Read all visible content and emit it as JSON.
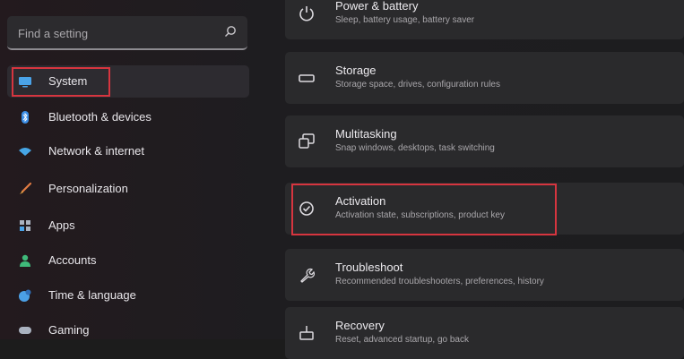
{
  "search": {
    "placeholder": "Find a setting"
  },
  "sidebar": {
    "items": [
      {
        "label": "System",
        "icon": "monitor-icon",
        "color": "#4aa3e8",
        "selected": true
      },
      {
        "label": "Bluetooth & devices",
        "icon": "bluetooth-icon",
        "color": "#3c8ee6",
        "selected": false
      },
      {
        "label": "Network & internet",
        "icon": "wifi-icon",
        "color": "#46a6e6",
        "selected": false
      },
      {
        "label": "Personalization",
        "icon": "brush-icon",
        "color": "#e27c43",
        "selected": false
      },
      {
        "label": "Apps",
        "icon": "apps-icon",
        "color": "#9aa2b0",
        "selected": false
      },
      {
        "label": "Accounts",
        "icon": "person-icon",
        "color": "#3fba7a",
        "selected": false
      },
      {
        "label": "Time & language",
        "icon": "globe-clock-icon",
        "color": "#4ba0e6",
        "selected": false
      },
      {
        "label": "Gaming",
        "icon": "gamepad-icon",
        "color": "#9aa2b0",
        "selected": false
      }
    ]
  },
  "settings": {
    "cards": [
      {
        "title": "Power & battery",
        "description": "Sleep, battery usage, battery saver",
        "icon": "power-icon"
      },
      {
        "title": "Storage",
        "description": "Storage space, drives, configuration rules",
        "icon": "storage-drive-icon"
      },
      {
        "title": "Multitasking",
        "description": "Snap windows, desktops, task switching",
        "icon": "multitasking-icon"
      },
      {
        "title": "Activation",
        "description": "Activation state, subscriptions, product key",
        "icon": "check-circle-icon"
      },
      {
        "title": "Troubleshoot",
        "description": "Recommended troubleshooters, preferences, history",
        "icon": "wrench-icon"
      },
      {
        "title": "Recovery",
        "description": "Reset, advanced startup, go back",
        "icon": "recovery-icon"
      }
    ]
  },
  "colors": {
    "highlight": "#d6353f",
    "background": "#1d1d1f",
    "card": "#2a2a2c"
  }
}
